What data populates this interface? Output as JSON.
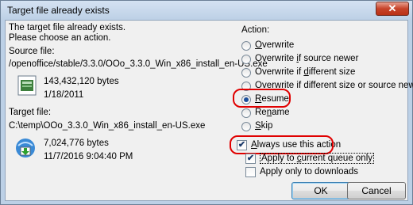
{
  "window": {
    "title": "Target file already exists",
    "close_symbol": "✕"
  },
  "message": {
    "line1": "The target file already exists.",
    "line2": "Please choose an action."
  },
  "source": {
    "label": "Source file:",
    "path": "/openoffice/stable/3.3.0/OOo_3.3.0_Win_x86_install_en-US.exe",
    "size": "143,432,120 bytes",
    "date": "1/18/2011"
  },
  "target": {
    "label": "Target file:",
    "path": "C:\\temp\\OOo_3.3.0_Win_x86_install_en-US.exe",
    "size": "7,024,776 bytes",
    "date": "11/7/2016 9:04:40 PM"
  },
  "action": {
    "label": "Action:",
    "options": [
      {
        "pre": "",
        "key": "O",
        "post": "verwrite"
      },
      {
        "pre": "Overwrite ",
        "key": "i",
        "post": "f source newer"
      },
      {
        "pre": "Overwrite if ",
        "key": "d",
        "post": "ifferent size"
      },
      {
        "pre": "Overwrite if different size or source newer",
        "key": "",
        "post": ""
      },
      {
        "pre": "",
        "key": "R",
        "post": "esume"
      },
      {
        "pre": "Re",
        "key": "n",
        "post": "ame"
      },
      {
        "pre": "",
        "key": "S",
        "post": "kip"
      }
    ],
    "selected_index": 4
  },
  "checkboxes": {
    "always": {
      "pre": "",
      "key": "A",
      "post": "lways use this action",
      "checked": true
    },
    "queue": {
      "pre": "Apply to ",
      "key": "c",
      "post": "urrent queue only",
      "checked": true
    },
    "downloads": {
      "pre": "Apply only to downloads",
      "key": "",
      "post": "",
      "checked": false
    }
  },
  "buttons": {
    "ok": "OK",
    "cancel": "Cancel"
  },
  "colors": {
    "highlight": "#e00000",
    "accent": "#1b4f9c"
  }
}
